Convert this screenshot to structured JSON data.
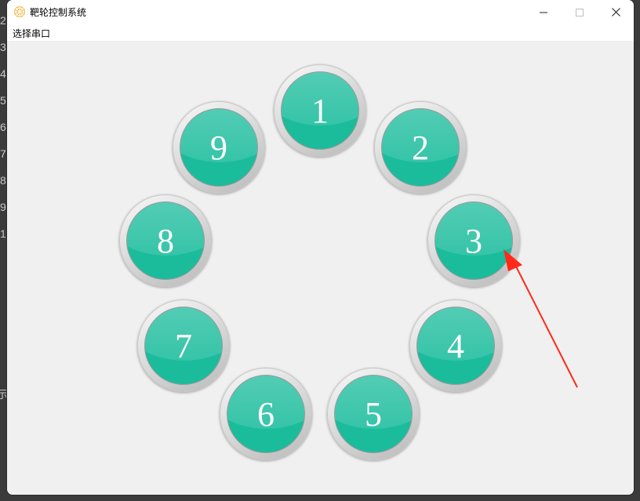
{
  "background_gutter": {
    "numbers": [
      "2",
      "3",
      "4",
      "5",
      "6",
      "7",
      "8",
      "9",
      "1"
    ],
    "bottom_char": "示"
  },
  "window": {
    "title": "靶轮控制系统",
    "app_icon": "wheel-icon",
    "controls": {
      "minimize": "minimize-icon",
      "maximize": "maximize-icon",
      "close": "close-icon"
    }
  },
  "menubar": {
    "items": [
      {
        "label": "选择串口"
      }
    ]
  },
  "dials": [
    {
      "label": "1"
    },
    {
      "label": "2"
    },
    {
      "label": "3"
    },
    {
      "label": "4"
    },
    {
      "label": "5"
    },
    {
      "label": "6"
    },
    {
      "label": "7"
    },
    {
      "label": "8"
    },
    {
      "label": "9"
    }
  ],
  "colors": {
    "dial_fill": "#1abc9c",
    "dial_ring": "#d9d9d9",
    "annotation_arrow": "#ff2a1a",
    "window_bg": "#f0f0f0"
  }
}
